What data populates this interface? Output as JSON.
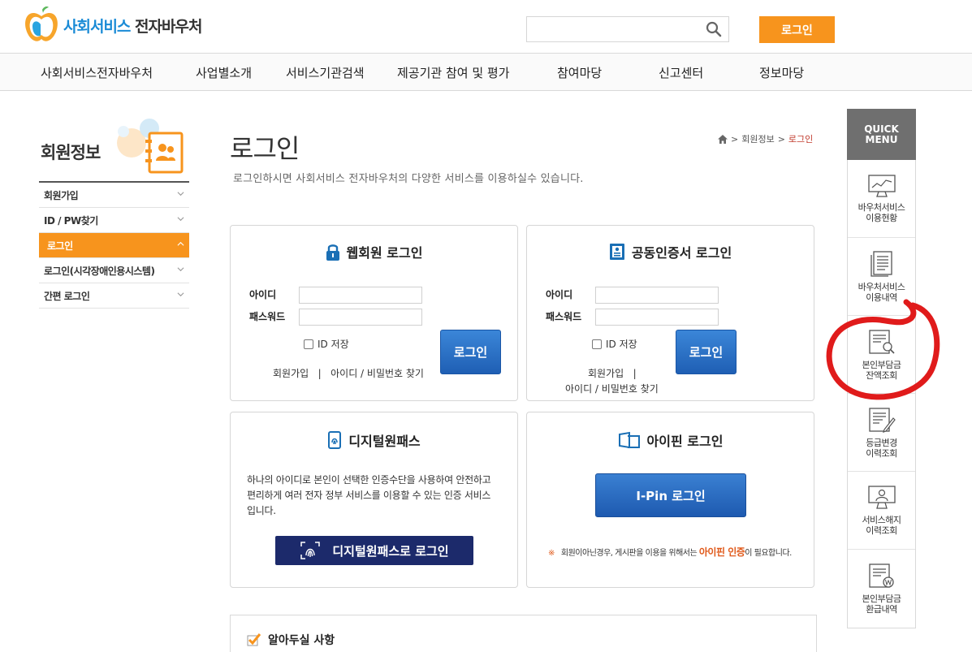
{
  "header": {
    "logo_part1": "사회서비스",
    "logo_part2": "전자바우처",
    "search_placeholder": "",
    "login_button": "로그인"
  },
  "gnb": [
    "사회서비스전자바우처",
    "사업별소개",
    "서비스기관검색",
    "제공기관 참여 및 평가",
    "참여마당",
    "신고센터",
    "정보마당"
  ],
  "sidebar": {
    "title": "회원정보",
    "items": [
      {
        "label": "회원가입"
      },
      {
        "label": "ID / PW찾기"
      },
      {
        "label": "로그인"
      },
      {
        "label": "로그인(시각장애인용시스템)"
      },
      {
        "label": "간편 로그인"
      }
    ]
  },
  "main": {
    "title": "로그인",
    "description": "로그인하시면 사회서비스 전자바우처의 다양한 서비스를 이용하실수 있습니다.",
    "breadcrumb": [
      "회원정보",
      "로그인"
    ]
  },
  "web_login": {
    "title": "웹회원 로그인",
    "id_label": "아이디",
    "pw_label": "패스워드",
    "save_id": "ID 저장",
    "login_button": "로그인",
    "signup_link": "회원가입",
    "separator": "|",
    "find_link": "아이디 / 비밀번호 찾기"
  },
  "cert_login": {
    "title": "공동인증서 로그인",
    "id_label": "아이디",
    "pw_label": "패스워드",
    "save_id": "ID 저장",
    "login_button": "로그인",
    "signup_link": "회원가입",
    "separator": "|",
    "find_link": "아이디 / 비밀번호 찾기"
  },
  "digital_pass": {
    "title": "디지털원패스",
    "description": "하나의 아이디로 본인이 선택한 인증수단을 사용하여 안전하고 편리하게 여러 전자 정부 서비스를 이용할 수 있는 인증 서비스 입니다.",
    "button": "디지털원패스로 로그인"
  },
  "ipin": {
    "title": "아이핀 로그인",
    "button": "I-Pin 로그인",
    "note_mark": "※",
    "note_before": "회원이아닌경우, 게시판을 이용을 위해서는 ",
    "note_emphasis": "아이핀 인증",
    "note_after": "이 필요합니다."
  },
  "notice": {
    "title": "알아두실 사항"
  },
  "quick_menu": {
    "title": "QUICK MENU",
    "items": [
      {
        "label": "바우처서비스\n이용현황",
        "icon": "chart-monitor-icon"
      },
      {
        "label": "바우처서비스\n이용내역",
        "icon": "document-list-icon"
      },
      {
        "label": "본인부담금\n잔액조회",
        "icon": "document-search-icon"
      },
      {
        "label": "등급변경\n이력조회",
        "icon": "document-edit-icon"
      },
      {
        "label": "서비스해지\n이력조회",
        "icon": "user-monitor-icon"
      },
      {
        "label": "본인부담금\n환급내역",
        "icon": "document-won-icon"
      }
    ]
  },
  "colors": {
    "accent": "#f7941d",
    "brand_blue": "#1a8bd6",
    "button_blue": "#1f5fb4",
    "annotation_red": "#e01b1b"
  }
}
